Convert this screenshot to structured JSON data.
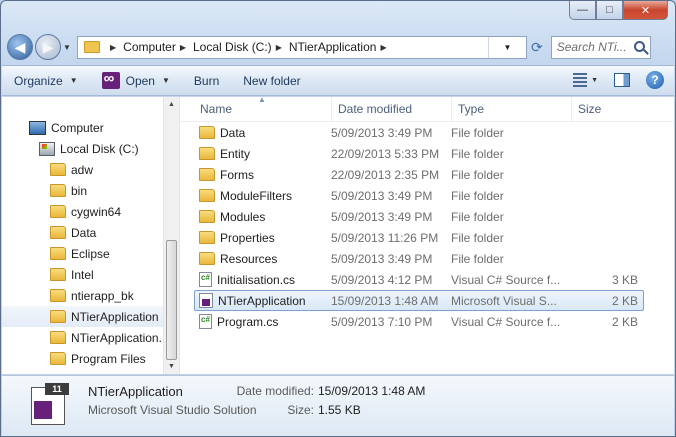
{
  "window": {
    "controls": {
      "minimize": "—",
      "maximize": "□",
      "close": "✕"
    }
  },
  "address": {
    "crumbs": [
      "Computer",
      "Local Disk (C:)",
      "NTierApplication"
    ],
    "search_placeholder": "Search NTi..."
  },
  "toolbar": {
    "organize": "Organize",
    "open": "Open",
    "burn": "Burn",
    "new_folder": "New folder",
    "help": "?"
  },
  "sidebar": {
    "computer": "Computer",
    "disk": "Local Disk (C:)",
    "folders": [
      "adw",
      "bin",
      "cygwin64",
      "Data",
      "Eclipse",
      "Intel",
      "ntierapp_bk",
      "NTierApplication",
      "NTierApplication...",
      "Program Files"
    ]
  },
  "columns": {
    "name": "Name",
    "date": "Date modified",
    "type": "Type",
    "size": "Size"
  },
  "files": [
    {
      "name": "Data",
      "date": "5/09/2013 3:49 PM",
      "type": "File folder",
      "size": "",
      "icon": "folder-icon"
    },
    {
      "name": "Entity",
      "date": "22/09/2013 5:33 PM",
      "type": "File folder",
      "size": "",
      "icon": "folder-icon"
    },
    {
      "name": "Forms",
      "date": "22/09/2013 2:35 PM",
      "type": "File folder",
      "size": "",
      "icon": "folder-icon"
    },
    {
      "name": "ModuleFilters",
      "date": "5/09/2013 3:49 PM",
      "type": "File folder",
      "size": "",
      "icon": "folder-icon"
    },
    {
      "name": "Modules",
      "date": "5/09/2013 3:49 PM",
      "type": "File folder",
      "size": "",
      "icon": "folder-icon"
    },
    {
      "name": "Properties",
      "date": "5/09/2013 11:26 PM",
      "type": "File folder",
      "size": "",
      "icon": "folder-icon"
    },
    {
      "name": "Resources",
      "date": "5/09/2013 3:49 PM",
      "type": "File folder",
      "size": "",
      "icon": "folder-icon"
    },
    {
      "name": "Initialisation.cs",
      "date": "5/09/2013 4:12 PM",
      "type": "Visual C# Source f...",
      "size": "3 KB",
      "icon": "csharp-file-icon"
    },
    {
      "name": "NTierApplication",
      "date": "15/09/2013 1:48 AM",
      "type": "Microsoft Visual S...",
      "size": "2 KB",
      "icon": "solution-file-icon"
    },
    {
      "name": "Program.cs",
      "date": "5/09/2013 7:10 PM",
      "type": "Visual C# Source f...",
      "size": "2 KB",
      "icon": "csharp-file-icon"
    }
  ],
  "details": {
    "name": "NTierApplication",
    "type": "Microsoft Visual Studio Solution",
    "badge": "11",
    "date_label": "Date modified:",
    "date_value": "15/09/2013 1:48 AM",
    "size_label": "Size:",
    "size_value": "1.55 KB"
  }
}
